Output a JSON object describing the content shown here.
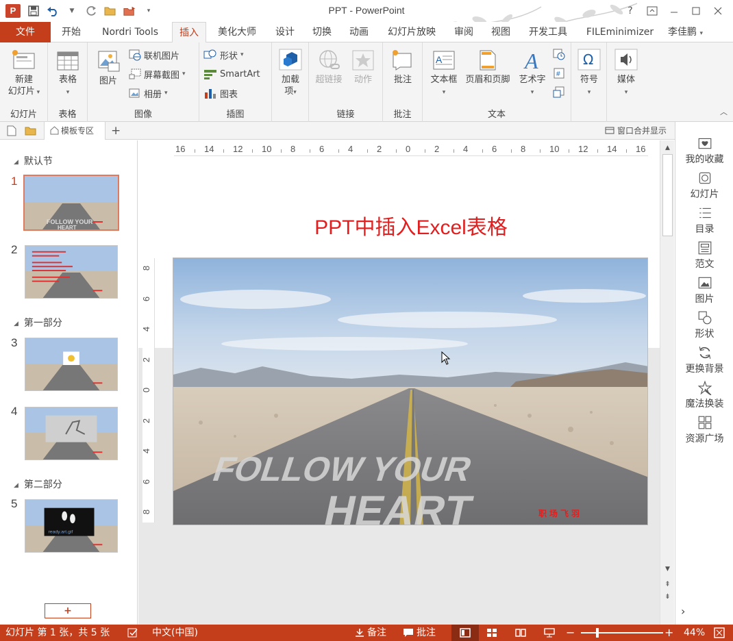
{
  "window": {
    "title": "PPT - PowerPoint",
    "logo_text": "P",
    "help": "?"
  },
  "tabs": [
    {
      "label": "文件",
      "kind": "file"
    },
    {
      "label": "开始"
    },
    {
      "label": "Nordri Tools"
    },
    {
      "label": "插入",
      "kind": "active"
    },
    {
      "label": "美化大师"
    },
    {
      "label": "设计"
    },
    {
      "label": "切换"
    },
    {
      "label": "动画"
    },
    {
      "label": "幻灯片放映"
    },
    {
      "label": "审阅"
    },
    {
      "label": "视图"
    },
    {
      "label": "开发工具"
    },
    {
      "label": "FILEminimizer"
    }
  ],
  "user": "李佳鹏",
  "ribbon": {
    "slides": {
      "group": "幻灯片",
      "new_slide_line1": "新建",
      "new_slide_line2": "幻灯片"
    },
    "tables": {
      "group": "表格",
      "table": "表格"
    },
    "images": {
      "group": "图像",
      "picture": "图片",
      "online_picture": "联机图片",
      "screenshot": "屏幕截图",
      "album": "相册"
    },
    "illustrations": {
      "group": "插图",
      "shapes": "形状",
      "smartart": "SmartArt",
      "chart": "图表"
    },
    "addins": {
      "group": "",
      "addins_line1": "加载",
      "addins_line2": "项"
    },
    "links": {
      "group": "链接",
      "hyperlink": "超链接",
      "action": "动作"
    },
    "comments": {
      "group": "批注",
      "comment": "批注"
    },
    "text": {
      "group": "文本",
      "textbox": "文本框",
      "header_footer": "页眉和页脚",
      "wordart": "艺术字"
    },
    "symbols": {
      "group": "",
      "symbol": "符号"
    },
    "media": {
      "group": "",
      "media": "媒体"
    }
  },
  "docbar": {
    "tab_label": "模板专区",
    "add": "+",
    "merge": "窗口合并显示"
  },
  "thumbs": {
    "sections": [
      "默认节",
      "第一部分",
      "第二部分"
    ],
    "slides": [
      "1",
      "2",
      "3",
      "4",
      "5"
    ],
    "add_button": "+",
    "thumb_gif_text": "ready.art.gif"
  },
  "slide": {
    "title": "PPT中插入Excel表格",
    "road_text_1": "FOLLOW YOUR",
    "road_text_2": "HEART",
    "watermark": "职场飞羽"
  },
  "ruler": {
    "h_labels": [
      "16",
      "14",
      "12",
      "10",
      "8",
      "6",
      "4",
      "2",
      "0",
      "2",
      "4",
      "6",
      "8",
      "10",
      "12",
      "14",
      "16"
    ],
    "v_labels": [
      "8",
      "6",
      "4",
      "2",
      "0",
      "2",
      "4",
      "6",
      "8"
    ]
  },
  "sidepanel": [
    {
      "label": "我的收藏",
      "icon": "favorites-icon"
    },
    {
      "label": "幻灯片",
      "icon": "slides-icon"
    },
    {
      "label": "目录",
      "icon": "toc-icon"
    },
    {
      "label": "范文",
      "icon": "template-doc-icon"
    },
    {
      "label": "图片",
      "icon": "picture-icon"
    },
    {
      "label": "形状",
      "icon": "shape-icon"
    },
    {
      "label": "更换背景",
      "icon": "refresh-background-icon"
    },
    {
      "label": "魔法换装",
      "icon": "magic-icon"
    },
    {
      "label": "资源广场",
      "icon": "grid-resources-icon"
    }
  ],
  "side_expand": "›",
  "status": {
    "slide_info": "幻灯片 第 1 张，共 5 张",
    "language": "中文(中国)",
    "notes": "备注",
    "comments": "批注",
    "zoom_minus": "−",
    "zoom_plus": "+",
    "zoom": "44%",
    "zoom_fraction": 0.2
  },
  "colors": {
    "accent": "#c43e1c",
    "title_red": "#e02020"
  }
}
